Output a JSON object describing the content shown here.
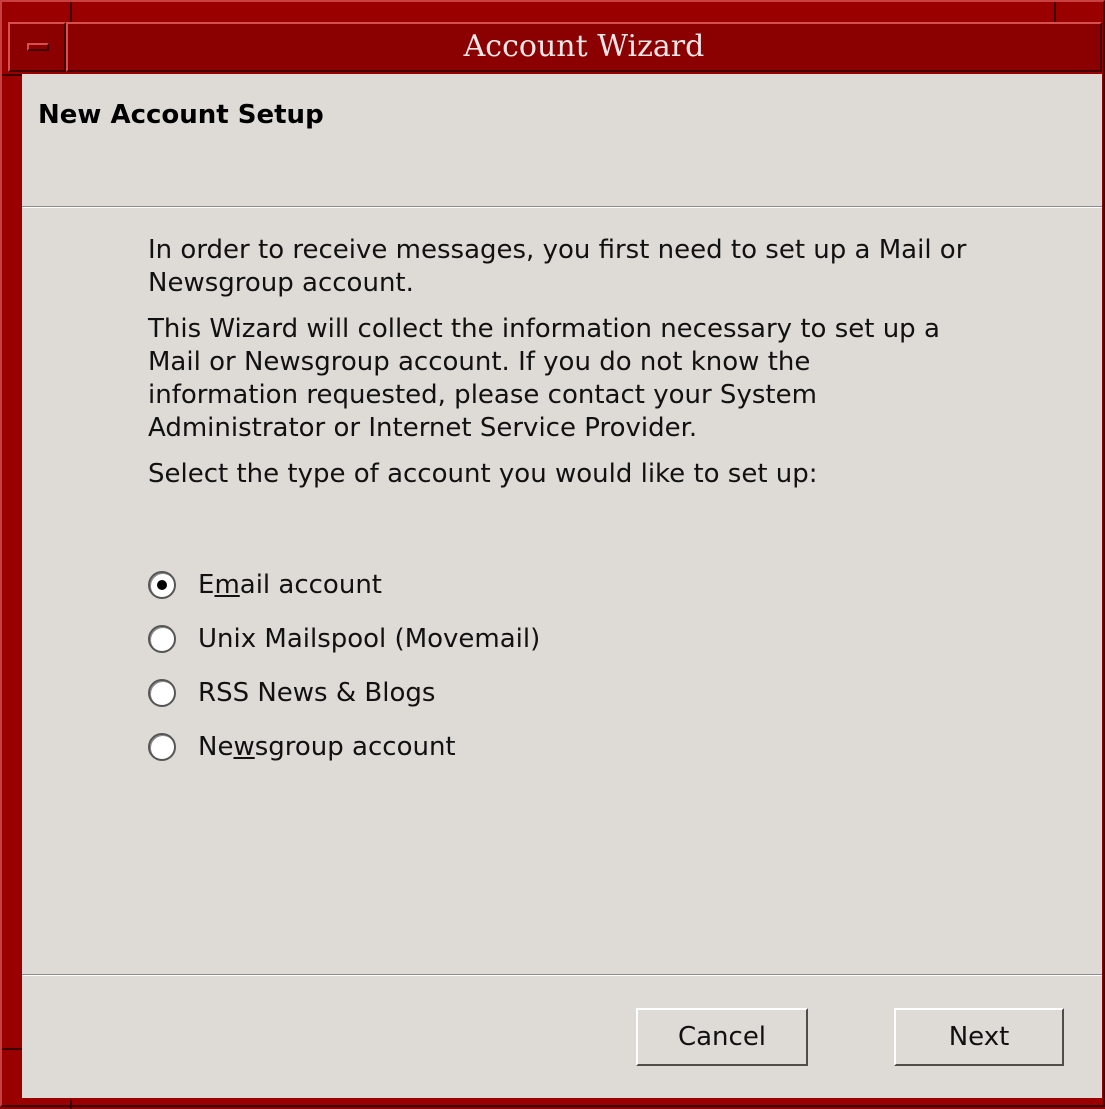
{
  "window": {
    "title": "Account Wizard"
  },
  "header": {
    "title": "New Account Setup"
  },
  "content": {
    "intro": "In order to receive messages, you first need to set up a Mail or Newsgroup account.",
    "info": "This Wizard will collect the information necessary to set up a Mail or Newsgroup account. If you do not know the information requested, please contact your System Administrator or Internet Service Provider.",
    "prompt": "Select the type of account you would like to set up:"
  },
  "options": [
    {
      "pre": "E",
      "accel": "m",
      "post": "ail account",
      "checked": true
    },
    {
      "pre": "Unix Mailspool (Movemail)",
      "accel": "",
      "post": "",
      "checked": false
    },
    {
      "pre": "RSS News & Blogs",
      "accel": "",
      "post": "",
      "checked": false
    },
    {
      "pre": "Ne",
      "accel": "w",
      "post": "sgroup account",
      "checked": false
    }
  ],
  "buttons": {
    "cancel": "Cancel",
    "next": "Next"
  },
  "colors": {
    "frame": "#8b0000",
    "dialog_bg": "#dedbd6"
  }
}
